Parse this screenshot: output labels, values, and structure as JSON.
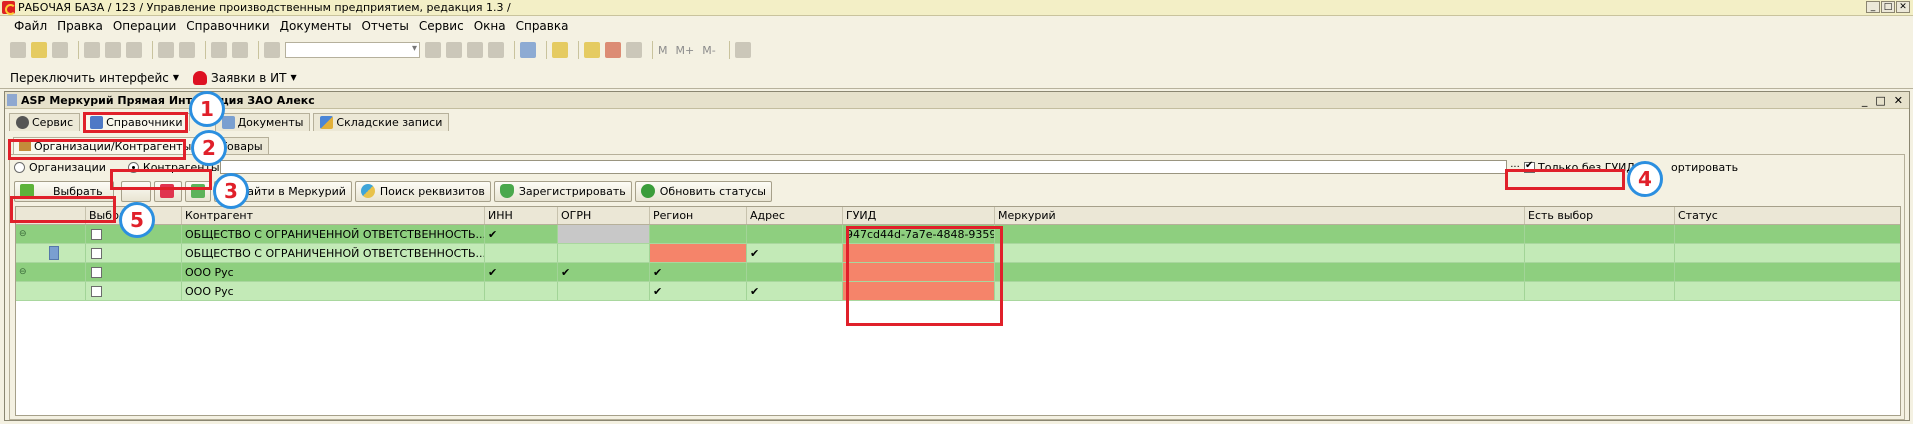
{
  "window": {
    "title": "РАБОЧАЯ БАЗА / 123 /  Управление производственным предприятием, редакция 1.3 /",
    "controls": [
      "_",
      "□",
      "✕"
    ]
  },
  "menu": [
    "Файл",
    "Правка",
    "Операции",
    "Справочники",
    "Документы",
    "Отчеты",
    "Сервис",
    "Окна",
    "Справка"
  ],
  "toolbar": {
    "labels": [
      "M",
      "M+",
      "M-"
    ]
  },
  "toolbar2": {
    "switch_interface": "Переключить интерфейс",
    "requests": "Заявки в ИТ"
  },
  "document": {
    "title": "ASP Меркурий Прямая Интеграция ЗАО Алекс",
    "controls": [
      "_",
      "□",
      "✕"
    ],
    "tabs": [
      "Сервис",
      "Справочники",
      "Документы",
      "Складские записи"
    ],
    "subtabs": [
      "Организации/Контрагенты",
      "Товары"
    ],
    "radios": [
      "Организации",
      "Контрагенты"
    ],
    "dots": "...",
    "only_without_guid": "Только без ГУИД",
    "sort_label": "ортировать",
    "buttons": {
      "select": "Выбрать",
      "find_mercury": "Найти в Меркурий",
      "search_details": "Поиск реквизитов",
      "register": "Зарегистрировать",
      "update_status": "Обновить статусы"
    },
    "columns": [
      "",
      "Выбран",
      "Контрагент",
      "ИНН",
      "ОГРН",
      "Регион",
      "Адрес",
      "ГУИД",
      "Меркурий",
      "Есть выбор",
      "Статус"
    ],
    "rows": [
      {
        "counterparty": "ОБЩЕСТВО С ОГРАНИЧЕННОЙ ОТВЕТСТВЕННОСТЬ...",
        "inn": "✔",
        "ogrn": "",
        "region": "",
        "address": "",
        "guid": "947cd44d-7a7e-4848-9359-..."
      },
      {
        "counterparty": "ОБЩЕСТВО С ОГРАНИЧЕННОЙ ОТВЕТСТВЕННОСТЬ...",
        "inn": "",
        "ogrn": "",
        "region": "",
        "address": "✔",
        "guid": ""
      },
      {
        "counterparty": "ООО Рус",
        "inn": "✔",
        "ogrn": "✔",
        "region": "✔",
        "address": "",
        "guid": ""
      },
      {
        "counterparty": "ООО Рус",
        "inn": "",
        "ogrn": "",
        "region": "✔",
        "address": "✔",
        "guid": ""
      }
    ]
  },
  "annotations": [
    "1",
    "2",
    "3",
    "4",
    "5"
  ],
  "colors": {
    "row_dark": "#8ecf7f",
    "row_light": "#c3eab7",
    "highlight": "#f5846a",
    "annotation_box": "#e0202a",
    "annotation_circle": "#2b8fe0"
  }
}
